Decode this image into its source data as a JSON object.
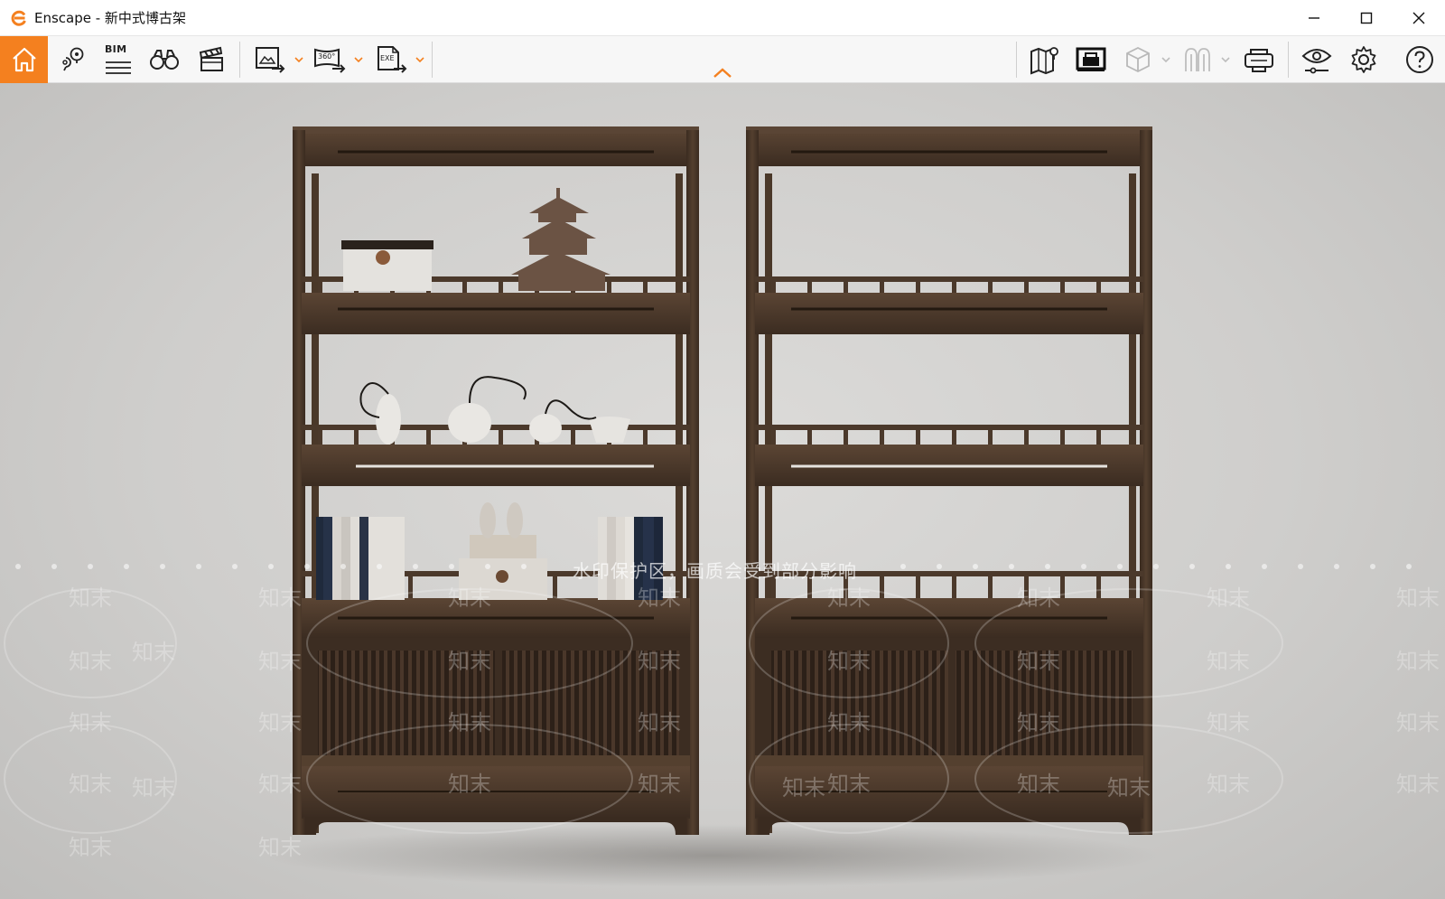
{
  "window": {
    "app_name": "Enscape",
    "title": "Enscape - 新中式博古架",
    "controls": [
      "minimize",
      "maximize",
      "close"
    ]
  },
  "toolbar": {
    "home": {
      "icon": "home-icon"
    },
    "left_tools": [
      {
        "name": "views",
        "icon": "location-pin-icon"
      },
      {
        "name": "bim",
        "label": "BIM",
        "icon": "bim-icon"
      },
      {
        "name": "binoculars",
        "icon": "binoculars-icon"
      },
      {
        "name": "video-editor",
        "icon": "clapperboard-icon"
      }
    ],
    "export_tools": [
      {
        "name": "export-image",
        "icon": "image-export-icon"
      },
      {
        "name": "export-panorama",
        "label": "360°",
        "icon": "panorama-export-icon"
      },
      {
        "name": "export-exe",
        "label": "EXE",
        "icon": "exe-export-icon"
      }
    ],
    "right_tools": [
      {
        "name": "map",
        "icon": "map-icon"
      },
      {
        "name": "asset-library",
        "icon": "asset-library-icon"
      },
      {
        "name": "cube",
        "icon": "cube-icon"
      },
      {
        "name": "people",
        "icon": "people-icon"
      },
      {
        "name": "vr-headset",
        "icon": "vr-headset-icon"
      },
      {
        "name": "visual-settings",
        "icon": "eye-icon"
      },
      {
        "name": "settings",
        "icon": "gear-icon"
      },
      {
        "name": "help",
        "icon": "help-icon"
      }
    ]
  },
  "viewport": {
    "watermark_text": "水印保护区，画质会受到部分影响",
    "watermark_logo": "知末",
    "scene": "two-wooden-display-shelves"
  },
  "colors": {
    "accent": "#f4801f",
    "wood_dark": "#3b2c21",
    "wood_mid": "#4e3a2c",
    "background": "#d3d2d0"
  }
}
